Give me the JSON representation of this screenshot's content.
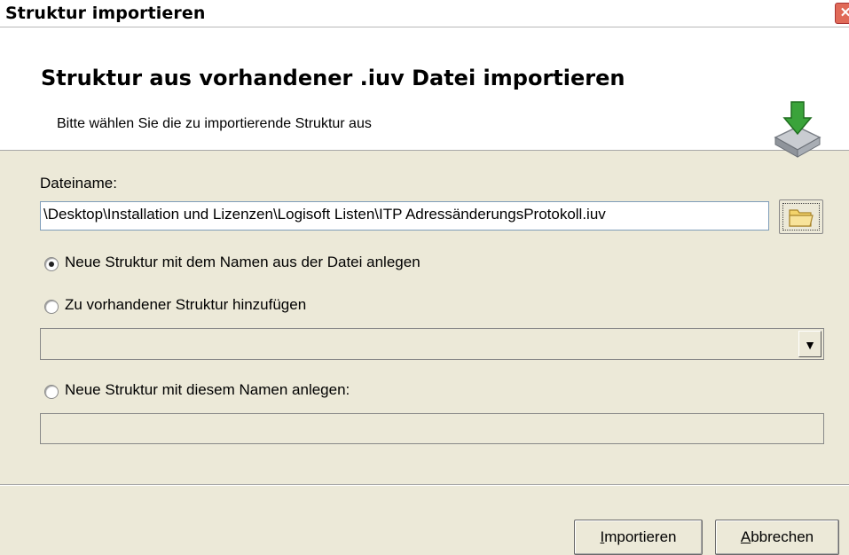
{
  "window": {
    "title": "Struktur importieren",
    "close_icon": "close-icon"
  },
  "header": {
    "title": "Struktur aus vorhandener .iuv Datei importieren",
    "subtitle": "Bitte wählen Sie die zu importierende Struktur aus",
    "icon": "import-download-icon",
    "icon_colors": {
      "arrow": "#3aa33a",
      "tray": "#9aa0a8"
    }
  },
  "form": {
    "filename_label": "Dateiname:",
    "filename_value": "\\Desktop\\Installation und Lizenzen\\Logisoft Listen\\ITP AdressänderungsProtokoll.iuv",
    "browse_icon": "folder-icon",
    "options": [
      {
        "label": "Neue Struktur mit dem Namen aus der Datei anlegen",
        "checked": true
      },
      {
        "label": "Zu vorhandener Struktur hinzufügen",
        "checked": false
      },
      {
        "label": "Neue Struktur mit diesem Namen anlegen:",
        "checked": false
      }
    ],
    "existing_structure_value": "",
    "new_name_value": ""
  },
  "buttons": {
    "import_first": "I",
    "import_rest": "mportieren",
    "cancel_first": "A",
    "cancel_rest": "bbrechen"
  }
}
